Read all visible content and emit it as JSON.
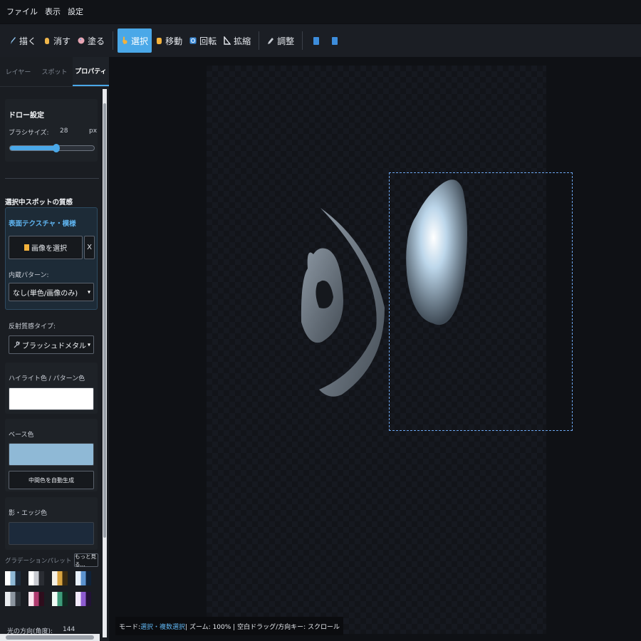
{
  "menu": [
    "ファイル",
    "表示",
    "設定"
  ],
  "toolbar": {
    "draw": "描く",
    "erase": "消す",
    "fill": "塗る",
    "select": "選択",
    "move": "移動",
    "rotate": "回転",
    "scale": "拡縮",
    "adjust": "調整"
  },
  "tabs": [
    "レイヤー",
    "スポット",
    "プロパティ"
  ],
  "draw_settings": {
    "title": "ドロー設定",
    "brush_size_label": "ブラシサイズ:",
    "brush_size_value": "28",
    "brush_size_unit": "px",
    "brush_level": 0.55
  },
  "material": {
    "title": "選択中スポットの質感",
    "texture_title": "表面テクスチャ・模様",
    "choose_image": "画像を選択",
    "clear": "X",
    "pattern_label": "内蔵パターン:",
    "pattern_value": "なし(単色/画像のみ)",
    "reflect_label": "反射質感タイプ:",
    "reflect_value": "ブラッシュドメタル",
    "highlight_label": "ハイライト色 / パターン色",
    "highlight_color": "#ffffff",
    "base_label": "ベース色",
    "base_color": "#8fb9d6",
    "auto_mid": "中間色を自動生成",
    "shadow_label": "影・エッジ色",
    "shadow_color": "#1c2a3b",
    "palette_label": "グラデーションパレット",
    "more": "もっと見る...",
    "light_dir_label": "光の方向(角度):",
    "light_dir_value": "144"
  },
  "palette_colors": [
    [
      "#ffffff",
      "#8fb9d6",
      "#1c2a3b"
    ],
    [
      "#ffffff",
      "#c9ccd2",
      "#2a2d33"
    ],
    [
      "#f5f1e6",
      "#d9a441",
      "#3a2a10"
    ],
    [
      "#e8f1fb",
      "#5b93cf",
      "#0f2238"
    ],
    [
      "#e9ecef",
      "#8c959f",
      "#2b3138"
    ],
    [
      "#fbe7f0",
      "#b03b6f",
      "#2e0d1c"
    ],
    [
      "#f1fbf6",
      "#3e9b7a",
      "#0e2a20"
    ],
    [
      "#f3eafb",
      "#8d5bd1",
      "#221236"
    ]
  ],
  "status": {
    "mode_label": "モード:",
    "mode_value": "選択・複数選択",
    "rest": "| ズーム: 100% | 空白ドラッグ/方向キー: スクロール"
  }
}
